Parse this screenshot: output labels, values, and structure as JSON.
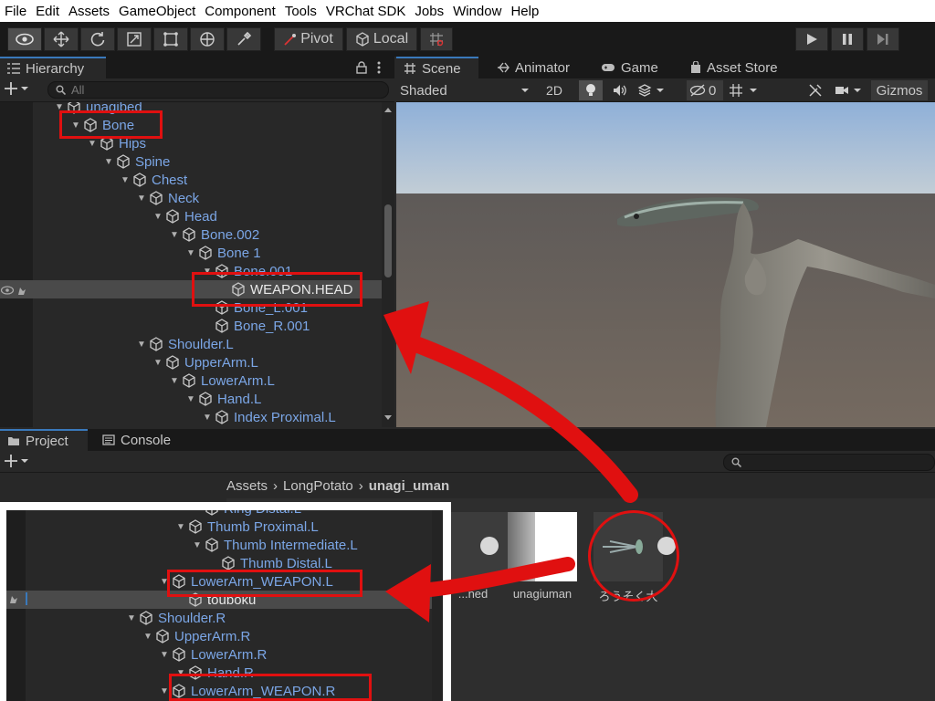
{
  "menu": [
    "File",
    "Edit",
    "Assets",
    "GameObject",
    "Component",
    "Tools",
    "VRChat SDK",
    "Jobs",
    "Window",
    "Help"
  ],
  "toolbar": {
    "pivot_label": "Pivot",
    "local_label": "Local"
  },
  "hierarchy": {
    "tab_label": "Hierarchy",
    "search_placeholder": "All",
    "rows": [
      {
        "label": "unagibed",
        "indent": 0
      },
      {
        "label": "Bone",
        "indent": 1
      },
      {
        "label": "Hips",
        "indent": 2
      },
      {
        "label": "Spine",
        "indent": 3
      },
      {
        "label": "Chest",
        "indent": 4
      },
      {
        "label": "Neck",
        "indent": 5
      },
      {
        "label": "Head",
        "indent": 6
      },
      {
        "label": "Bone.002",
        "indent": 7
      },
      {
        "label": "Bone 1",
        "indent": 8
      },
      {
        "label": "Bone.001",
        "indent": 9
      },
      {
        "label": "WEAPON.HEAD",
        "indent": 10
      },
      {
        "label": "Bone_L.001",
        "indent": 9
      },
      {
        "label": "Bone_R.001",
        "indent": 9
      },
      {
        "label": "Shoulder.L",
        "indent": 5
      },
      {
        "label": "UpperArm.L",
        "indent": 6
      },
      {
        "label": "LowerArm.L",
        "indent": 7
      },
      {
        "label": "Hand.L",
        "indent": 8
      },
      {
        "label": "Index Proximal.L",
        "indent": 9
      }
    ]
  },
  "scene": {
    "tabs": [
      "Scene",
      "Animator",
      "Game",
      "Asset Store"
    ],
    "shading_mode": "Shaded",
    "mode_2d": "2D",
    "hidden_count": "0",
    "gizmos_label": "Gizmos"
  },
  "project": {
    "tabs": [
      "Project",
      "Console"
    ],
    "breadcrumb": [
      "Assets",
      "LongPotato",
      "unagi_uman"
    ],
    "assets": [
      {
        "name": "...ned"
      },
      {
        "name": "unagiuman"
      },
      {
        "name": "ろうそく大"
      }
    ]
  },
  "inset": {
    "rows": [
      {
        "label": "Ring Distal.L",
        "indent": 10
      },
      {
        "label": "Thumb Proximal.L",
        "indent": 9
      },
      {
        "label": "Thumb Intermediate.L",
        "indent": 10
      },
      {
        "label": "Thumb Distal.L",
        "indent": 11
      },
      {
        "label": "LowerArm_WEAPON.L",
        "indent": 8
      },
      {
        "label": "touboku",
        "indent": 9
      },
      {
        "label": "Shoulder.R",
        "indent": 6
      },
      {
        "label": "UpperArm.R",
        "indent": 7
      },
      {
        "label": "LowerArm.R",
        "indent": 8
      },
      {
        "label": "Hand.R",
        "indent": 9
      },
      {
        "label": "LowerArm_WEAPON.R",
        "indent": 8
      }
    ]
  },
  "colors": {
    "highlight": "#e01010",
    "link_text": "#7ba6e6",
    "accent": "#3a79bb"
  }
}
